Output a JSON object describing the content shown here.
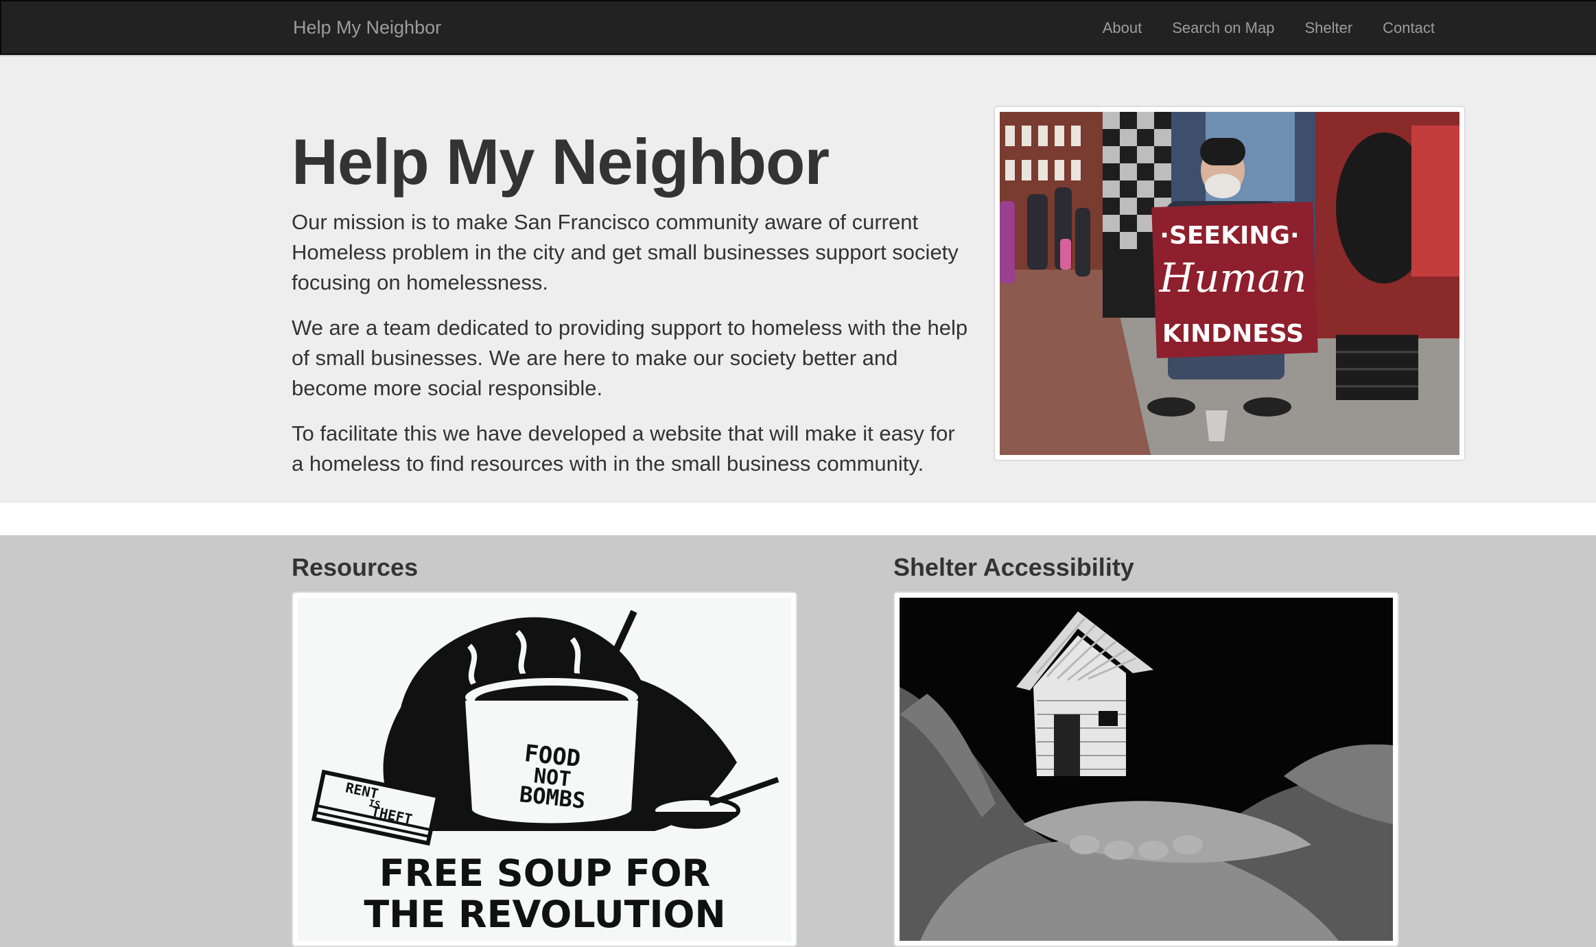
{
  "navbar": {
    "brand": "Help My Neighbor",
    "links": [
      "About",
      "Search on Map",
      "Shelter",
      "Contact"
    ]
  },
  "hero": {
    "title": "Help My Neighbor",
    "paragraphs": [
      "Our mission is to make San Francisco community aware of current Homeless problem in the city and get small businesses support society focusing on homelessness.",
      "We are a team dedicated to providing support to homeless with the help of small businesses. We are here to make our society better and become more social responsible.",
      "To facilitate this we have developed a website that will make it easy for a homeless to find resources with in the small business community."
    ],
    "photo_sign": {
      "line1": "·SEEKING·",
      "line2": "Human",
      "line3": "KINDNESS"
    }
  },
  "sections": {
    "resources": {
      "title": "Resources",
      "poster": {
        "pot_text": [
          "FOOD",
          "NOT",
          "BOMBS"
        ],
        "book_text": [
          "RENT",
          "IS",
          "THEFT"
        ],
        "slogan": [
          "FREE SOUP FOR",
          "THE REVOLUTION"
        ]
      }
    },
    "shelter": {
      "title": "Shelter Accessibility"
    }
  }
}
